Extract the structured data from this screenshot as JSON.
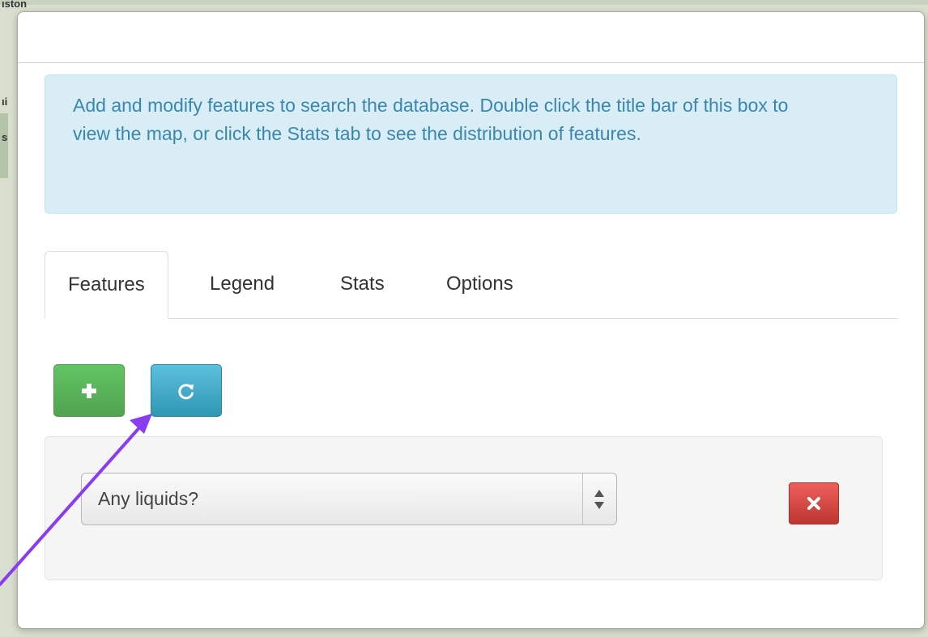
{
  "map": {
    "labels": [
      "ıston",
      "ıi",
      "s"
    ]
  },
  "dialog": {
    "info_message": "Add and modify features to search the database. Double click the title bar of this box to view the map, or click the Stats tab to see the distribution of features."
  },
  "tabs": [
    {
      "label": "Features",
      "active": true
    },
    {
      "label": "Legend",
      "active": false
    },
    {
      "label": "Stats",
      "active": false
    },
    {
      "label": "Options",
      "active": false
    }
  ],
  "toolbar": {
    "add_icon": "plus-icon",
    "refresh_icon": "refresh-icon"
  },
  "feature": {
    "selected_value": "Any liquids?",
    "delete_icon": "times-icon"
  },
  "colors": {
    "info_bg": "#d9edf7",
    "info_text": "#3a87ad",
    "add_button": "#5bb75b",
    "refresh_button": "#49afcd",
    "delete_button": "#da4f49",
    "annotation_arrow": "#8a3cf0"
  }
}
